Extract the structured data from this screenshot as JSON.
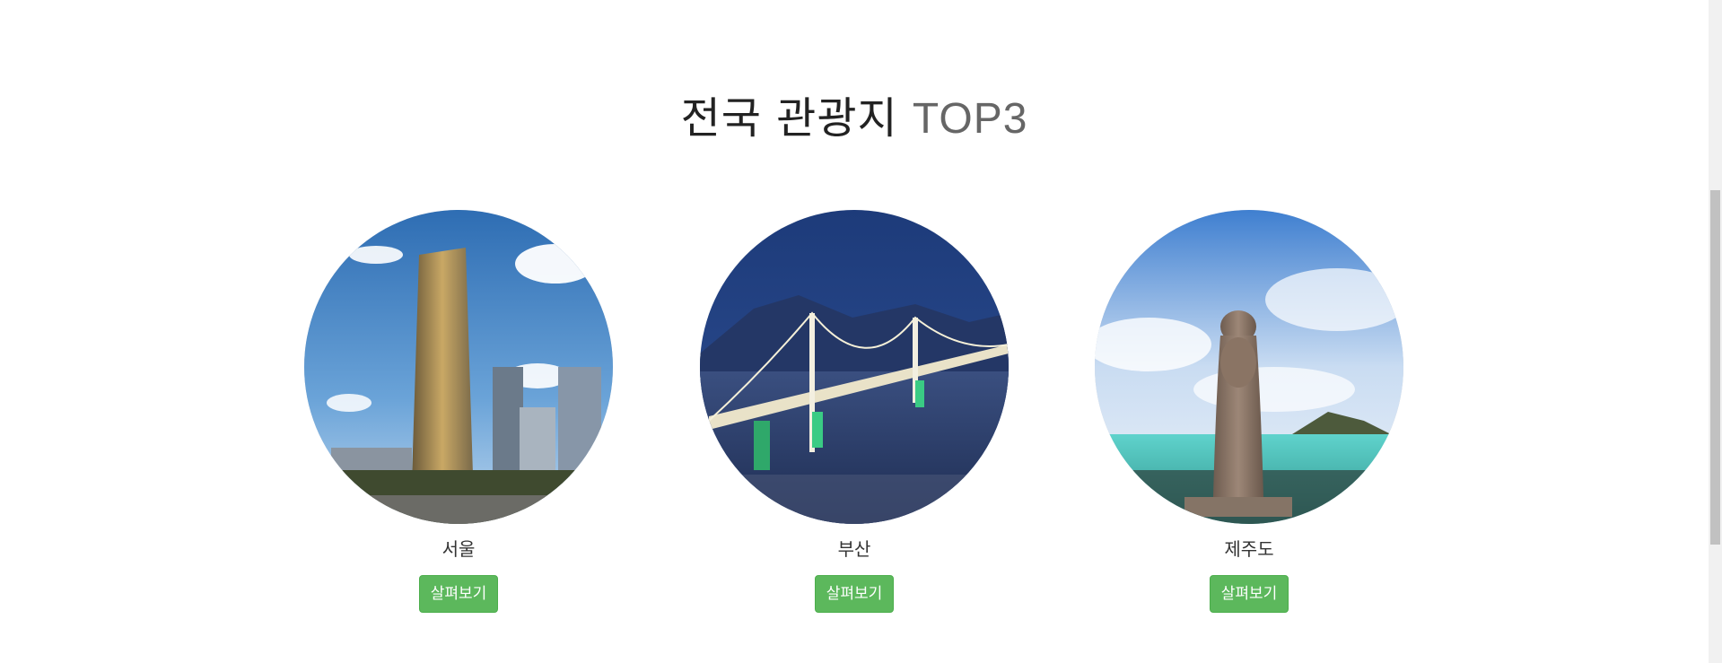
{
  "section": {
    "title_main": "전국 관광지",
    "title_accent": "TOP3"
  },
  "destinations": [
    {
      "name": "서울",
      "button_label": "살펴보기",
      "image": "seoul-skyscraper"
    },
    {
      "name": "부산",
      "button_label": "살펴보기",
      "image": "busan-gwangan-bridge"
    },
    {
      "name": "제주도",
      "button_label": "살펴보기",
      "image": "jeju-dol-hareubang"
    }
  ],
  "colors": {
    "button_bg": "#5cb85c",
    "title_text": "#222222",
    "accent_text": "#666666"
  }
}
